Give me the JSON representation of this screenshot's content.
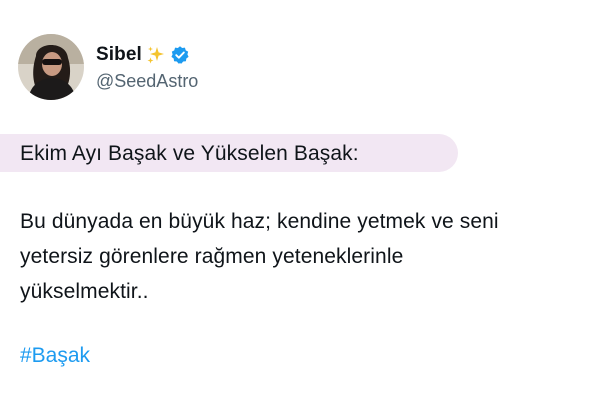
{
  "profile": {
    "display_name": "Sibel",
    "handle": "@SeedAstro",
    "name_emoji": "sparkles-icon",
    "verified_icon": "verified-badge-icon"
  },
  "tweet": {
    "heading": "Ekim Ayı Başak ve Yükselen Başak:",
    "body_lines": [
      "Bu dünyada en büyük haz; kendine yetmek ve seni",
      "yetersiz görenlere rağmen yeteneklerinle",
      "yükselmektir.."
    ],
    "hashtag": "#Başak"
  },
  "colors": {
    "text": "#0f1419",
    "secondary_text": "#536471",
    "hashtag": "#1d9bf0",
    "verified": "#1d9bf0",
    "heading_highlight": "#f2e7f3"
  }
}
